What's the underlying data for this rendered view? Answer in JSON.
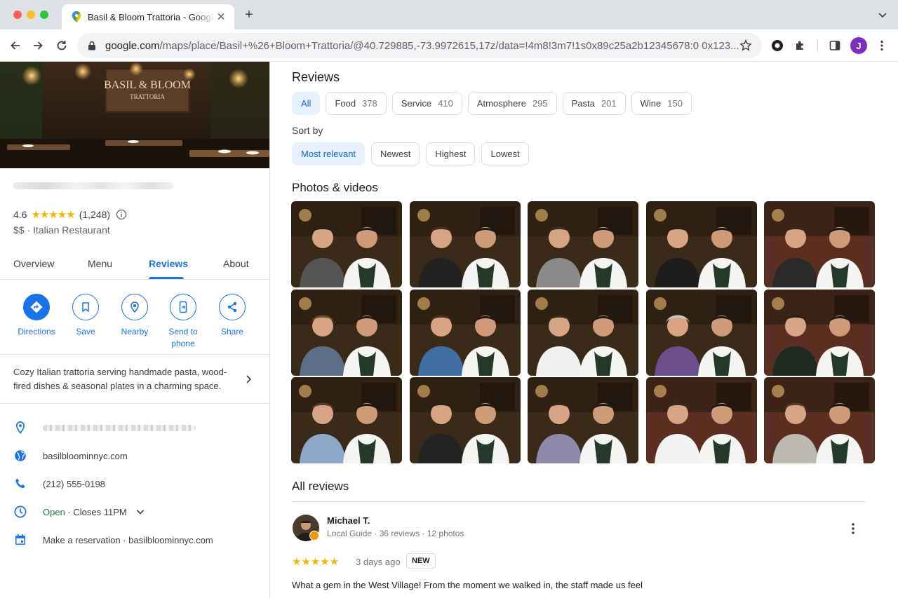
{
  "browser": {
    "tab_title": "Basil & Bloom Trattoria - Google Maps",
    "new_tab": "+",
    "url_host": "google.com",
    "url_path": "/maps/place/Basil+%26+Bloom+Trattoria/@40.729885,-73.9972615,17z/data=!4m8!3m7!1s0x89c25a2b12345678:0 0x123...",
    "profile_initial": "J"
  },
  "place": {
    "rating": "4.6",
    "stars": "★★★★★",
    "review_count": "(1,248)",
    "price": "$$",
    "category": "Italian Restaurant",
    "hero_sign_line1": "BASIL & BLOOM",
    "hero_sign_line2": "TRATTORIA",
    "tabs": [
      "Overview",
      "Menu",
      "Reviews",
      "About"
    ],
    "actions": {
      "directions": "Directions",
      "save": "Save",
      "nearby": "Nearby",
      "send_line1": "Send to",
      "send_line2": "phone",
      "share": "Share"
    },
    "description_line1": "Cozy Italian trattoria serving handmade pasta, wood-",
    "description_line2": "fired dishes & seasonal plates in a charming space.",
    "website": "basilbloominnyc.com",
    "phone": "(212) 555-0198",
    "hours_status": "Open",
    "hours_close": " · Closes 11PM",
    "reservation": "Make a reservation · basilbloominnyc.com"
  },
  "reviews": {
    "heading": "Reviews",
    "chips": [
      {
        "label": "All",
        "count": ""
      },
      {
        "label": "Food",
        "count": "378"
      },
      {
        "label": "Service",
        "count": "410"
      },
      {
        "label": "Atmosphere",
        "count": "295"
      },
      {
        "label": "Pasta",
        "count": "201"
      },
      {
        "label": "Wine",
        "count": "150"
      }
    ],
    "sort_label": "Sort by",
    "sorts": [
      "Most relevant",
      "Newest",
      "Highest",
      "Lowest"
    ],
    "photos_heading": "Photos & videos",
    "all_heading": "All reviews",
    "first": {
      "name": "Michael T.",
      "meta": "Local Guide · 36 reviews · 12 photos",
      "stars": "★★★★★",
      "time": "3 days ago",
      "badge": "NEW",
      "text": "What a gem in the West Village! From the moment we walked in, the staff made us feel"
    }
  },
  "colors": {
    "accent": "#1a73e8",
    "star": "#f4b400",
    "open": "#188038"
  }
}
